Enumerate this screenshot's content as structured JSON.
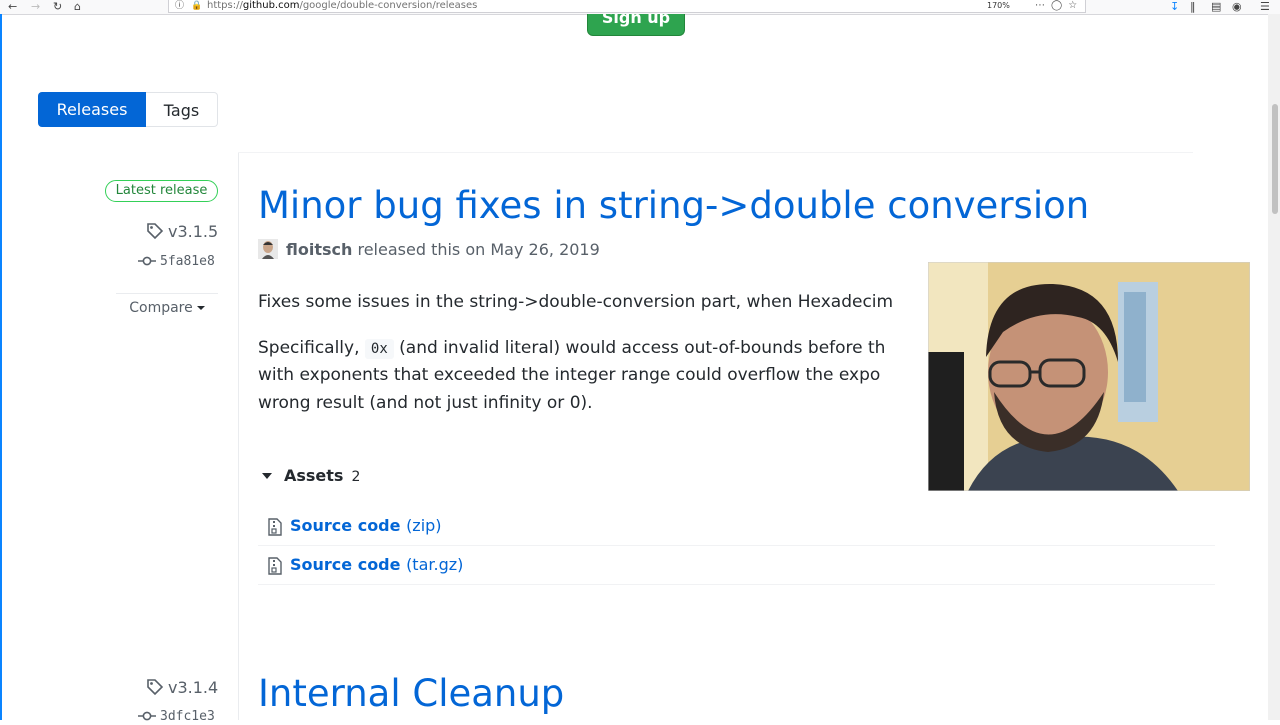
{
  "browser": {
    "url_scheme": "https://",
    "url_host": "github.com",
    "url_path": "/google/double-conversion/releases",
    "zoom": "170%"
  },
  "header": {
    "signup_label": "Sign up"
  },
  "tabs": [
    {
      "label": "Releases",
      "selected": true
    },
    {
      "label": "Tags",
      "selected": false
    }
  ],
  "releases": [
    {
      "badge": "Latest release",
      "tag": "v3.1.5",
      "commit": "5fa81e8",
      "compare_label": "Compare",
      "title": "Minor bug fixes in string->double conversion",
      "author": "floitsch",
      "released_text": "released this on May 26, 2019",
      "body_p1": "Fixes some issues in the string->double-conversion part, when Hexadecim",
      "body_p2_a": "Specifically,",
      "body_p2_code": "0x",
      "body_p2_b": "(and invalid literal) would access out-of-bounds before th",
      "body_p2_line2": "with exponents that exceeded the integer range could overflow the expo",
      "body_p2_line3": "wrong result (and not just infinity or 0).",
      "assets_label": "Assets",
      "assets_count": "2",
      "assets": [
        {
          "name": "Source code",
          "format": "(zip)"
        },
        {
          "name": "Source code",
          "format": "(tar.gz)"
        }
      ]
    },
    {
      "tag": "v3.1.4",
      "commit": "3dfc1e3",
      "title": "Internal Cleanup"
    }
  ],
  "colors": {
    "link": "#0366d6",
    "signup": "#2ea44f",
    "badge": "#22863a"
  }
}
